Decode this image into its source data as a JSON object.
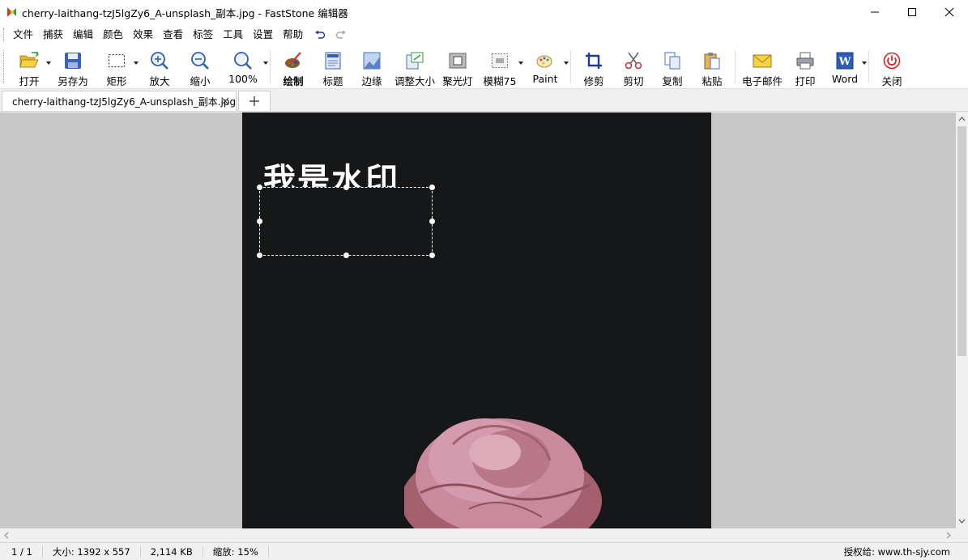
{
  "window": {
    "title": "cherry-laithang-tzJ5lgZy6_A-unsplash_副本.jpg - FastStone 编辑器"
  },
  "menu": {
    "items": [
      "文件",
      "捕获",
      "编辑",
      "颜色",
      "效果",
      "查看",
      "标签",
      "工具",
      "设置",
      "帮助"
    ]
  },
  "toolbar": {
    "open": "打开",
    "save_as": "另存为",
    "rect": "矩形",
    "zoom_in": "放大",
    "zoom_out": "缩小",
    "zoom_level": "100%",
    "draw": "绘制",
    "caption": "标题",
    "edge": "边缘",
    "resize": "调整大小",
    "spotlight": "聚光灯",
    "blur": "模糊75",
    "paint": "Paint",
    "crop": "修剪",
    "cut": "剪切",
    "copy": "复制",
    "paste": "粘贴",
    "email": "电子邮件",
    "print": "打印",
    "word": "Word",
    "close": "关闭"
  },
  "tab": {
    "label": "cherry-laithang-tzJ5lgZy6_A-unsplash_副本.jpg"
  },
  "image": {
    "watermark_text": "我是水印"
  },
  "status": {
    "page": "1 / 1",
    "size": "大小: 1392 x 557",
    "filesize": "2,114 KB",
    "zoom": "缩放: 15%",
    "license": "授权给: www.th-sjy.com"
  },
  "colors": {
    "image_bg": "#161718",
    "canvas_bg": "#c8c8c8",
    "rose": "#c98a9e"
  }
}
